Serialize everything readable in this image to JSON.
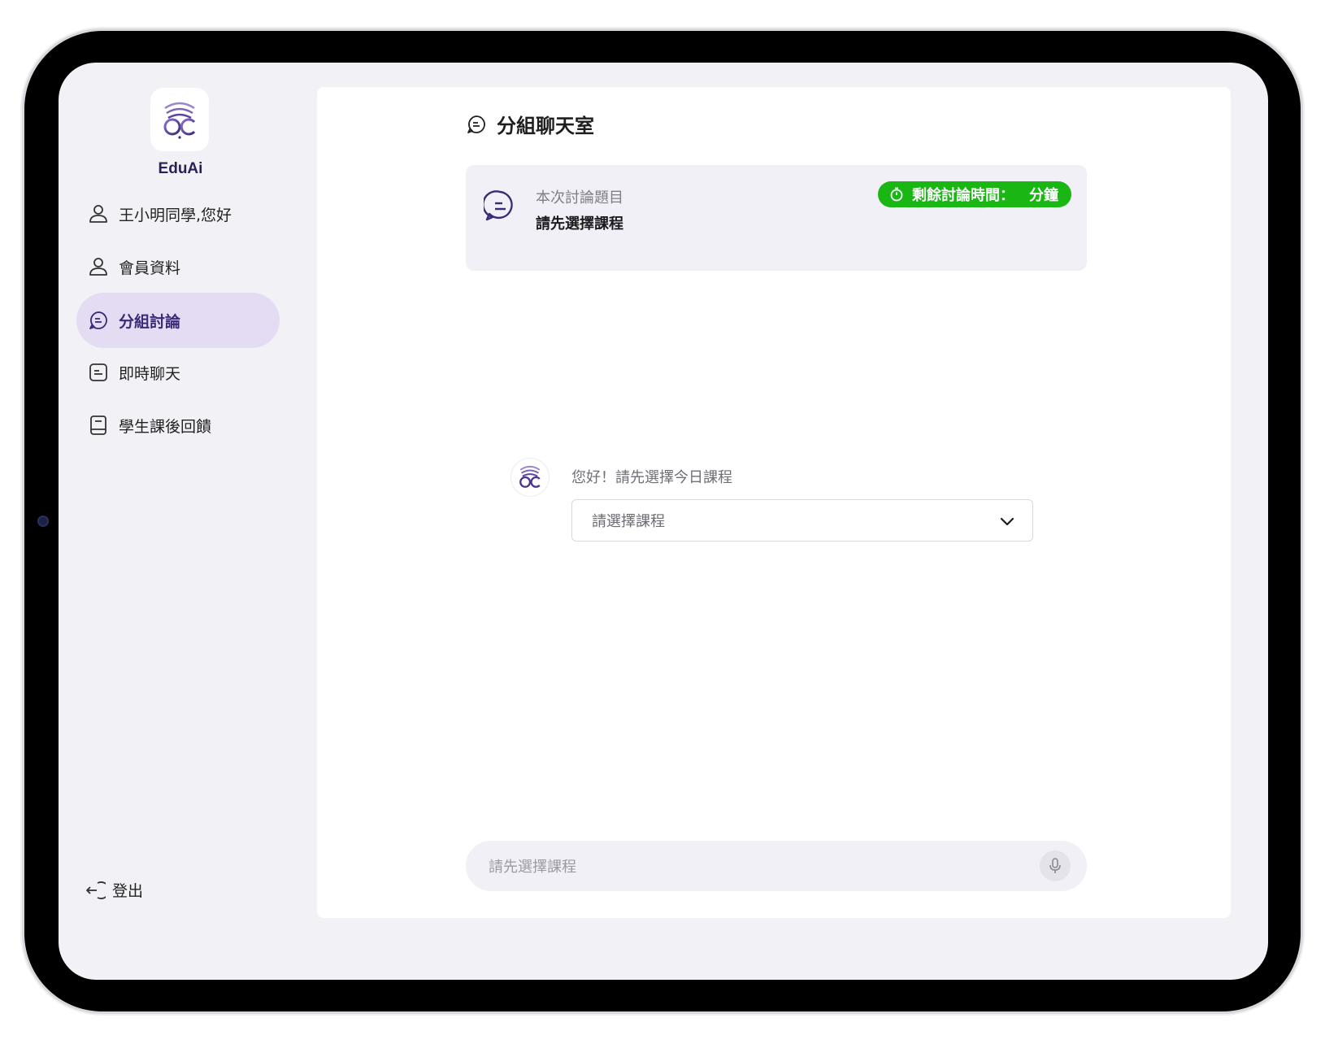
{
  "brand": {
    "name": "EduAi",
    "logo_icon": "edu-ai-logo-icon"
  },
  "sidebar": {
    "items": [
      {
        "label": "王小明同學,您好",
        "icon": "user-icon",
        "active": false
      },
      {
        "label": "會員資料",
        "icon": "user-icon",
        "active": false
      },
      {
        "label": "分組討論",
        "icon": "chat-bubble-icon",
        "active": true
      },
      {
        "label": "即時聊天",
        "icon": "message-square-icon",
        "active": false
      },
      {
        "label": "學生課後回饋",
        "icon": "book-icon",
        "active": false
      }
    ],
    "logout_label": "登出"
  },
  "main": {
    "title": "分組聊天室",
    "topic": {
      "caption": "本次討論題目",
      "value": "請先選擇課程",
      "timer_label": "剩餘討論時間：",
      "timer_unit": "分鐘"
    },
    "bot": {
      "greeting": "您好！請先選擇今日課程",
      "select_placeholder": "請選擇課程"
    },
    "input": {
      "placeholder": "請先選擇課程"
    }
  },
  "colors": {
    "accent": "#3a2a78",
    "active_bg": "#e3dcf3",
    "timer_green": "#1ab714"
  }
}
